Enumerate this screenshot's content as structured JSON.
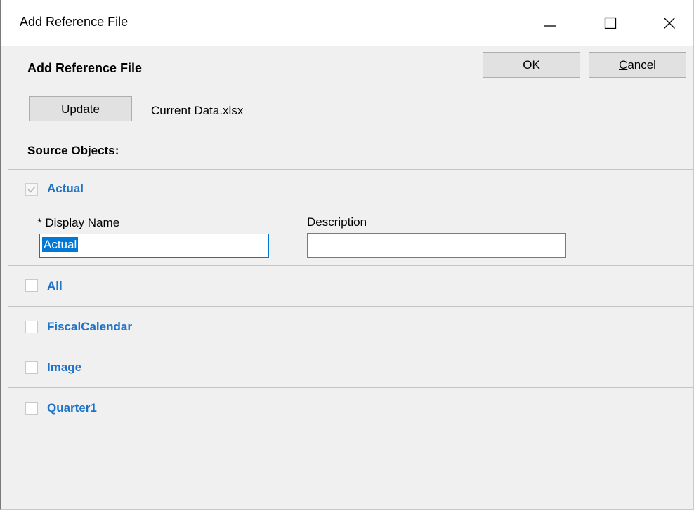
{
  "window": {
    "title": "Add Reference File",
    "min_icon": "minimize-icon",
    "max_icon": "maximize-icon",
    "close_icon": "close-icon"
  },
  "header": {
    "heading": "Add Reference File",
    "ok_label": "OK",
    "cancel_first": "C",
    "cancel_rest": "ancel"
  },
  "file": {
    "update_label": "Update",
    "name": "Current Data.xlsx"
  },
  "source": {
    "label": "Source Objects:",
    "items": [
      {
        "label": "Actual",
        "checked": true,
        "expanded": true
      },
      {
        "label": "All",
        "checked": false
      },
      {
        "label": "FiscalCalendar",
        "checked": false
      },
      {
        "label": "Image",
        "checked": false
      },
      {
        "label": "Quarter1",
        "checked": false
      }
    ],
    "display_name_label": "* Display Name",
    "display_name_value": "Actual",
    "description_label": "Description",
    "description_value": ""
  },
  "colors": {
    "item_label": "#1e73c8",
    "selection": "#0078d7"
  }
}
